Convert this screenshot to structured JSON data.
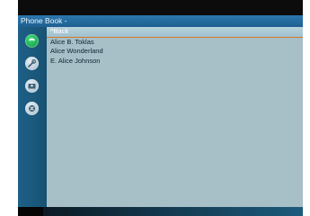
{
  "window": {
    "title": "Phone Book -"
  },
  "sidebar": {
    "buttons": [
      {
        "name": "call",
        "icon": "phone-icon",
        "color": "#1fb856"
      },
      {
        "name": "settings",
        "icon": "wrench-icon",
        "color": "#c9d8e2"
      },
      {
        "name": "contact-card",
        "icon": "contact-card-icon",
        "color": "#c9d8e2"
      },
      {
        "name": "close",
        "icon": "close-icon",
        "color": "#c9d8e2"
      }
    ]
  },
  "list": {
    "back_label": "^Back",
    "items": [
      {
        "label": "Alice B. Toklas"
      },
      {
        "label": "Alice Wonderland"
      },
      {
        "label": "E. Alice Johnson"
      }
    ]
  },
  "colors": {
    "title_bar": "#2468a0",
    "list_bg": "#a7bfc6",
    "selection_underline": "#d17a2c"
  }
}
